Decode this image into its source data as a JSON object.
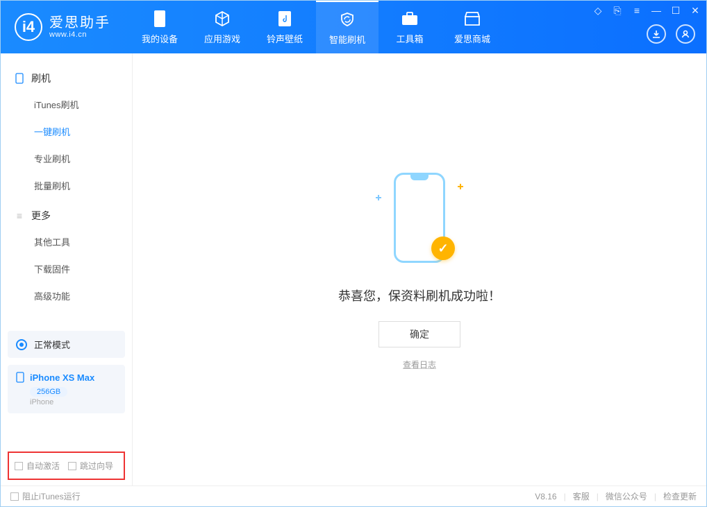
{
  "app": {
    "name": "爱思助手",
    "domain": "www.i4.cn"
  },
  "tabs": [
    "我的设备",
    "应用游戏",
    "铃声壁纸",
    "智能刷机",
    "工具箱",
    "爱思商城"
  ],
  "activeTab": 3,
  "sidebar": {
    "flash": {
      "title": "刷机",
      "items": [
        "iTunes刷机",
        "一键刷机",
        "专业刷机",
        "批量刷机"
      ],
      "active": 1
    },
    "more": {
      "title": "更多",
      "items": [
        "其他工具",
        "下载固件",
        "高级功能"
      ]
    }
  },
  "mode": "正常模式",
  "device": {
    "name": "iPhone XS Max",
    "capacity": "256GB",
    "type": "iPhone"
  },
  "opts": {
    "autoActivate": "自动激活",
    "skipGuide": "跳过向导"
  },
  "main": {
    "message": "恭喜您，保资料刷机成功啦！",
    "ok": "确定",
    "log": "查看日志"
  },
  "footer": {
    "blockItunes": "阻止iTunes运行",
    "version": "V8.16",
    "links": [
      "客服",
      "微信公众号",
      "检查更新"
    ]
  }
}
